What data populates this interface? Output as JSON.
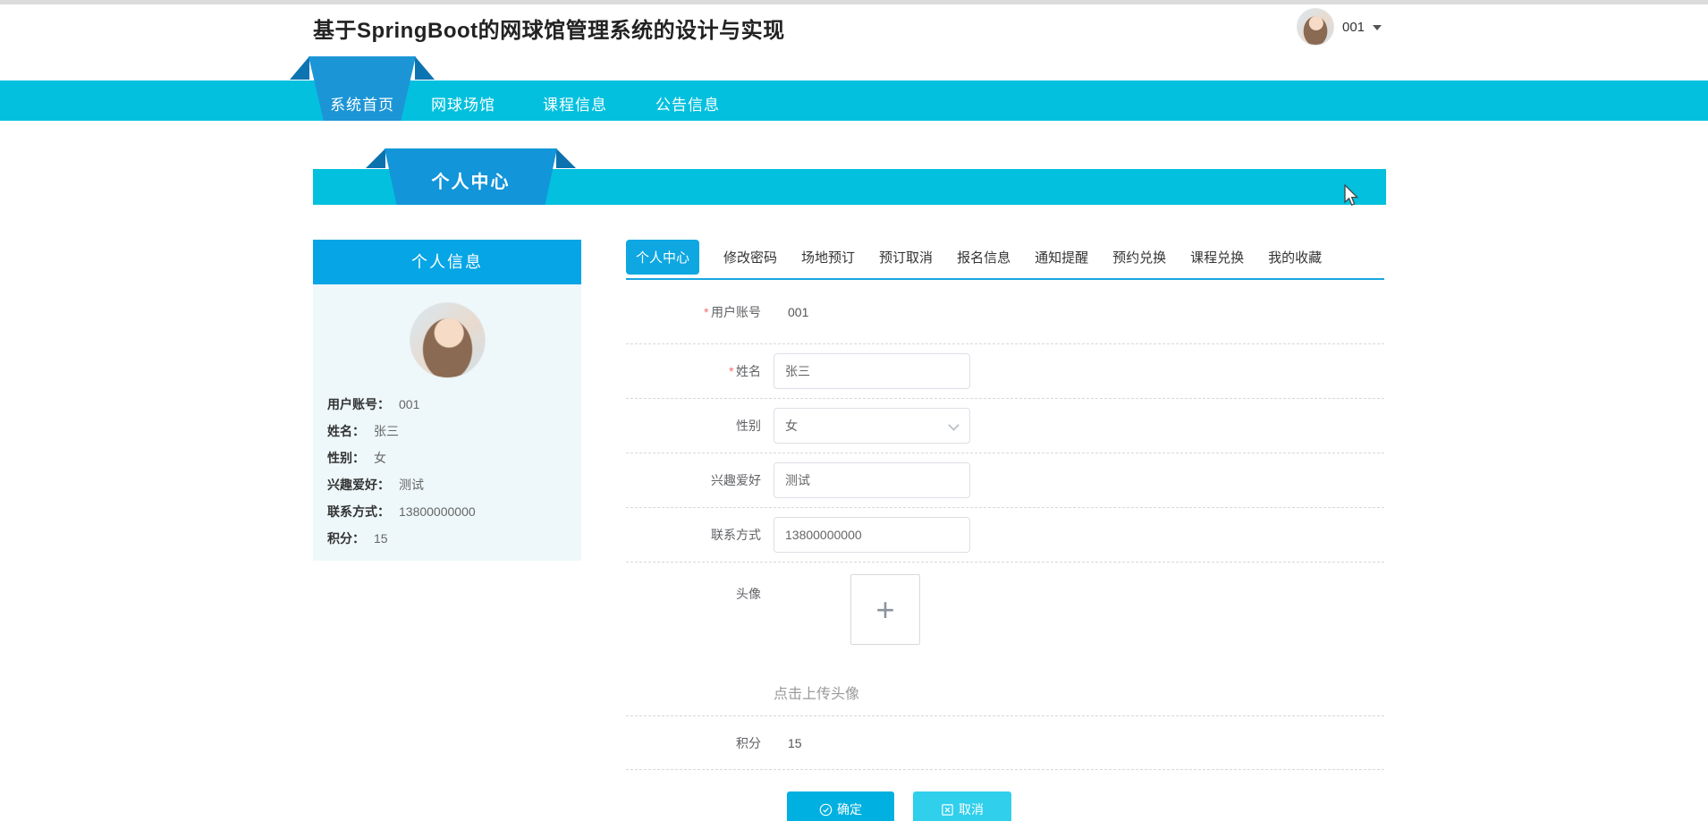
{
  "page": {
    "top_title": "基于SpringBoot的网球馆管理系统的设计与实现"
  },
  "header": {
    "username": "001"
  },
  "nav": {
    "items": [
      "系统首页",
      "网球场馆",
      "课程信息",
      "公告信息"
    ]
  },
  "banner": {
    "title": "个人中心"
  },
  "sidebar": {
    "title": "个人信息",
    "fields": [
      {
        "label": "用户账号：",
        "value": "001"
      },
      {
        "label": "姓名：",
        "value": "张三"
      },
      {
        "label": "性别：",
        "value": "女"
      },
      {
        "label": "兴趣爱好：",
        "value": "测试"
      },
      {
        "label": "联系方式：",
        "value": "13800000000"
      },
      {
        "label": "积分：",
        "value": "15"
      }
    ]
  },
  "tabs": [
    "个人中心",
    "修改密码",
    "场地预订",
    "预订取消",
    "报名信息",
    "通知提醒",
    "预约兑换",
    "课程兑换",
    "我的收藏"
  ],
  "form": {
    "account": {
      "label": "用户账号",
      "required": "*",
      "value": "001"
    },
    "name": {
      "label": "姓名",
      "required": "*",
      "value": "张三"
    },
    "gender": {
      "label": "性别",
      "value": "女"
    },
    "hobby": {
      "label": "兴趣爱好",
      "value": "测试"
    },
    "phone": {
      "label": "联系方式",
      "value": "13800000000"
    },
    "avatar": {
      "label": "头像",
      "plus": "+",
      "upload_hint": "点击上传头像"
    },
    "points": {
      "label": "积分",
      "value": "15"
    },
    "confirm_label": "确定",
    "cancel_label": "取消"
  },
  "icons": {
    "user_caret": "chevron-down",
    "select_chevron": "chevron-down",
    "confirm": "circle-check",
    "cancel": "square-close",
    "upload": "plus",
    "pointer": "arrow-cursor"
  },
  "colors": {
    "nav_cyan": "#03c0de",
    "ribbon_blue": "#1c95d6",
    "ribbon_fold": "#0d74b2",
    "panel_head_blue": "#06a5e5",
    "active_tab_blue": "#0ea7e2",
    "tab_underline": "#17a6e0",
    "confirm_button": "#00b0e0",
    "cancel_button": "#30cfec",
    "required_red": "#f56c6c",
    "panel_body_bg": "#eef8fa"
  }
}
